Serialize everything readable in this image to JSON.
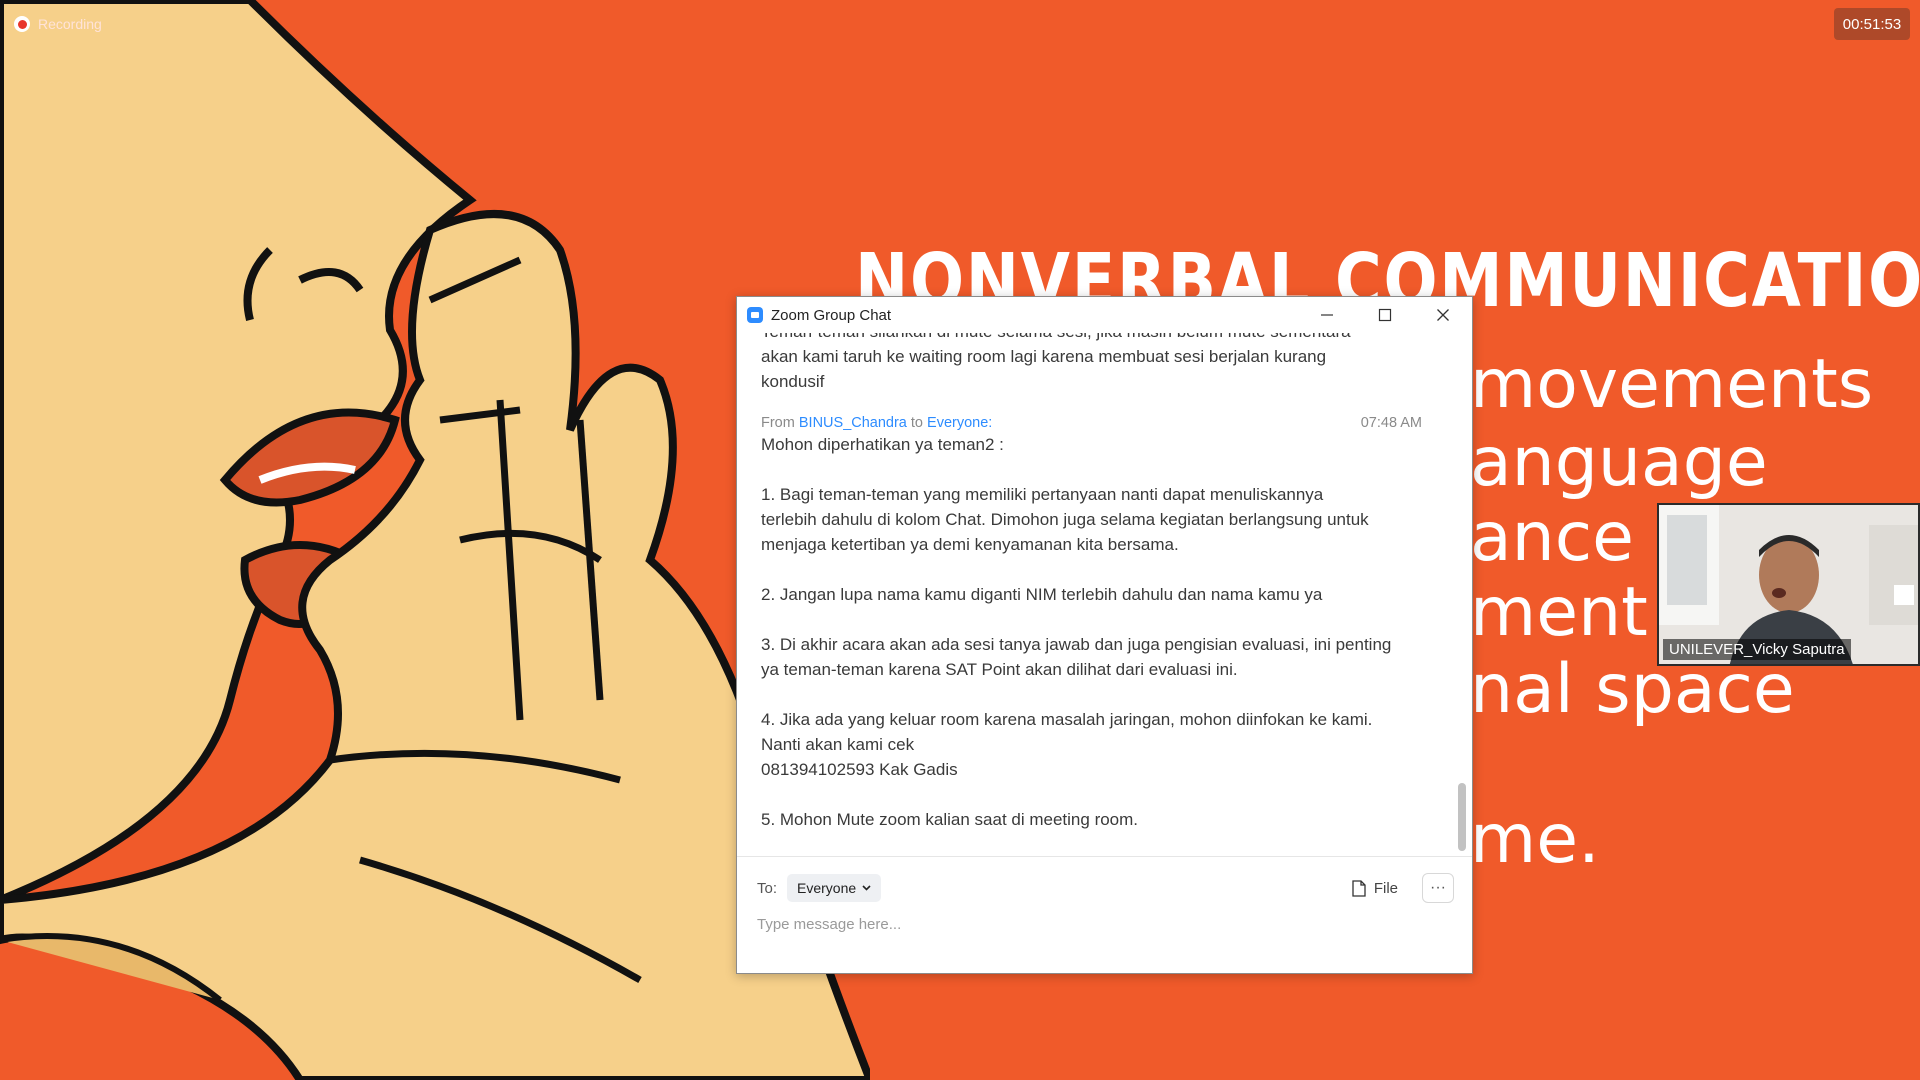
{
  "recording": {
    "label": "Recording"
  },
  "timer": {
    "value": "00:51:53"
  },
  "slide": {
    "title": "NONVERBAL COMMUNICATION",
    "lines": [
      "movements",
      "anguage",
      "ance",
      "ment",
      "nal space",
      "me."
    ]
  },
  "participant": {
    "name": "UNILEVER_Vicky Saputra"
  },
  "chat_window": {
    "title": "Zoom Group Chat",
    "prev_message": "Teman-teman silahkan di mute selama sesi, jika masih belum mute sementara\nakan kami taruh ke waiting room lagi karena membuat sesi berjalan kurang\nkondusif",
    "message": {
      "from_prefix": "From",
      "sender": "BINUS_Chandra",
      "to_word": "to",
      "recipient": "Everyone:",
      "time": "07:48 AM",
      "body": "Mohon diperhatikan ya teman2 :\n\n1. Bagi teman-teman yang memiliki pertanyaan nanti dapat menuliskannya\nterlebih dahulu di kolom Chat. Dimohon juga selama kegiatan berlangsung untuk\nmenjaga ketertiban ya demi kenyamanan kita bersama.\n\n2. Jangan lupa nama kamu diganti NIM terlebih dahulu dan nama kamu ya\n\n3. Di akhir acara akan ada sesi tanya jawab dan juga pengisian evaluasi, ini penting\nya teman-teman karena SAT Point akan dilihat dari evaluasi ini.\n\n4. Jika ada yang keluar room karena masalah jaringan, mohon diinfokan ke kami.\nNanti akan kami cek\n081394102593 Kak Gadis\n\n5. Mohon Mute zoom kalian saat di meeting room."
    },
    "to_label": "To:",
    "recipient_select": "Everyone",
    "file_label": "File",
    "more_label": "···",
    "input_placeholder": "Type message here..."
  },
  "colors": {
    "slide_bg": "#f05a2a",
    "accent_blue": "#2d8cff",
    "skin": "#f6d08a",
    "lip": "#d9542b"
  },
  "icons": [
    "record-icon",
    "zoom-app-icon",
    "minimize-icon",
    "maximize-icon",
    "close-icon",
    "chevron-down-icon",
    "file-icon",
    "more-icon"
  ]
}
